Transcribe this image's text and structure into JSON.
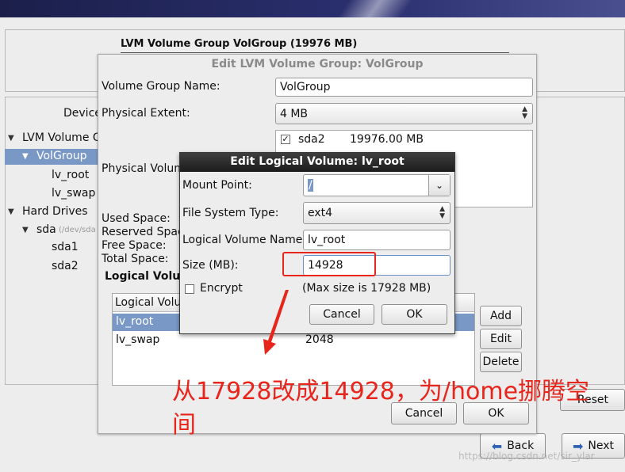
{
  "lvm_panel": {
    "title": "LVM Volume Group VolGroup (19976 MB)"
  },
  "tree": {
    "device_label": "Device",
    "items": [
      "LVM Volume G",
      "VolGroup",
      "lv_root",
      "lv_swap",
      "Hard Drives",
      "sda",
      "(/dev/sda",
      "sda1",
      "sda2"
    ]
  },
  "vg_dialog": {
    "title": "Edit LVM Volume Group: VolGroup",
    "vg_name_label": "Volume Group Name:",
    "vg_name_value": "VolGroup",
    "pe_label": "Physical Extent:",
    "pe_value": "4 MB",
    "pv_label": "Physical Volum",
    "pv_items": [
      {
        "name": "sda2",
        "size": "19976.00 MB"
      }
    ],
    "stats_labels": [
      "Used Space:",
      "Reserved Space",
      "Free Space:",
      "Total Space:"
    ],
    "lv_section_label": "Logical Volu",
    "lv_table": {
      "header": "Logical Volu",
      "rows": [
        {
          "name": "lv_root",
          "size": ""
        },
        {
          "name": "lv_swap",
          "size": "2048"
        }
      ]
    },
    "add_label": "Add",
    "edit_label": "Edit",
    "delete_label": "Delete",
    "cancel_label": "Cancel",
    "ok_label": "OK"
  },
  "lv_dialog": {
    "title": "Edit Logical Volume: lv_root",
    "mount_label": "Mount Point:",
    "mount_value": "/",
    "fs_label": "File System Type:",
    "fs_value": "ext4",
    "lvname_label": "Logical Volume Name:",
    "lvname_value": "lv_root",
    "size_label": "Size (MB):",
    "size_value": "14928",
    "encrypt_label": "Encrypt",
    "max_size": "(Max size is 17928 MB)",
    "cancel_label": "Cancel",
    "ok_label": "OK"
  },
  "main_buttons": {
    "reset_label": "Reset",
    "back_label": "Back",
    "next_label": "Next"
  },
  "annotation": {
    "line1": "从17928改成14928，为/home挪腾空",
    "line2": "间",
    "color": "#e8251c"
  },
  "watermark": "https://blog.csdn.net/sir_ylar"
}
